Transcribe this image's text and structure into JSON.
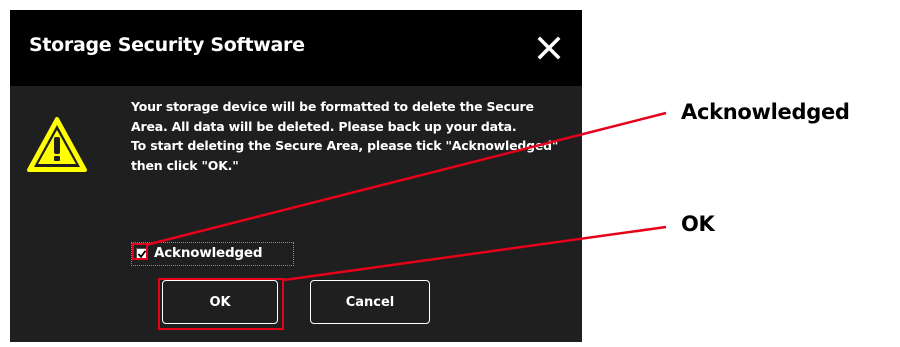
{
  "dialog": {
    "title": "Storage Security Software",
    "message_lines": [
      "Your storage device will be formatted to delete the Secure Area. All data will be deleted. Please back up your data.",
      "To start deleting the Secure Area, please tick \"Acknowledged\" then click \"OK.\""
    ],
    "checkbox": {
      "label": "Acknowledged",
      "checked": true
    },
    "ok_label": "OK",
    "cancel_label": "Cancel"
  },
  "icons": {
    "close": "close-icon",
    "warning": "warning-icon",
    "checkmark": "checkmark-icon"
  },
  "annotations": {
    "acknowledged_label": "Acknowledged",
    "ok_label": "OK",
    "highlight_color": "#e6001a"
  },
  "colors": {
    "dialog_background": "#1f1f1f",
    "titlebar_background": "#000000",
    "text": "#ffffff",
    "warning_yellow": "#ffff00"
  }
}
